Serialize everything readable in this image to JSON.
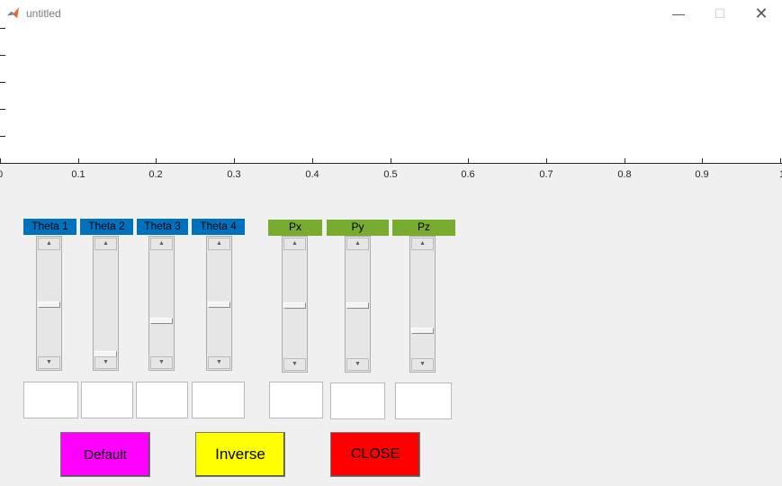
{
  "window": {
    "title": "untitled",
    "icon": "matlab-logo-icon",
    "minimize_glyph": "—",
    "maximize_glyph": "☐",
    "close_glyph": "✕"
  },
  "axes": {
    "x_ticks": [
      "0",
      "0.1",
      "0.2",
      "0.3",
      "0.4",
      "0.5",
      "0.6",
      "0.7",
      "0.8",
      "0.9",
      "1"
    ]
  },
  "joint_sliders": [
    {
      "label": "Theta 1",
      "value": 0.5,
      "edit_value": ""
    },
    {
      "label": "Theta 2",
      "value": 0.0,
      "edit_value": ""
    },
    {
      "label": "Theta 3",
      "value": 0.33,
      "edit_value": ""
    },
    {
      "label": "Theta 4",
      "value": 0.5,
      "edit_value": ""
    }
  ],
  "position_sliders": [
    {
      "label": "Px",
      "value": 0.5,
      "edit_value": ""
    },
    {
      "label": "Py",
      "value": 0.5,
      "edit_value": ""
    },
    {
      "label": "Pz",
      "value": 0.25,
      "edit_value": ""
    }
  ],
  "buttons": {
    "default": "Default",
    "inverse": "Inverse",
    "close": "CLOSE"
  },
  "colors": {
    "joint_label_bg": "#0072bd",
    "position_label_bg": "#77ac30",
    "default_button": "#ff00ff",
    "inverse_button": "#ffff00",
    "close_button": "#ff0000"
  }
}
